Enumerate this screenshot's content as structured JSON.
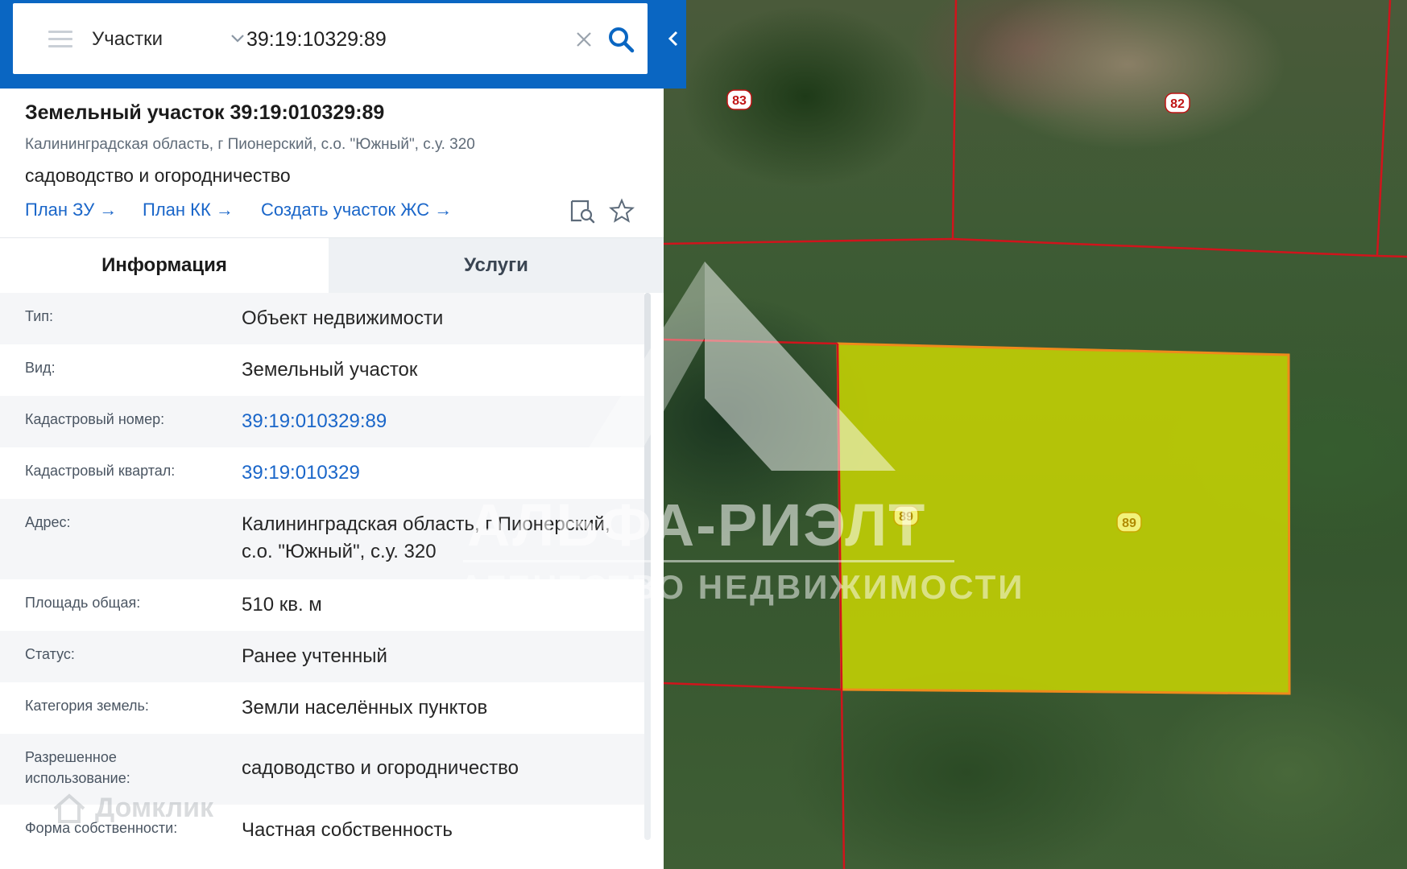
{
  "search": {
    "type_label": "Участки",
    "query": "39:19:10329:89"
  },
  "object": {
    "title": "Земельный участок 39:19:010329:89",
    "address": "Калининградская область, г Пионерский, с.о. \"Южный\", с.у. 320",
    "usage": "садоводство и огородничество",
    "links": [
      "План ЗУ →",
      "План КК →",
      "Создать участок ЖС →"
    ]
  },
  "tabs": [
    {
      "label": "Информация",
      "active": true
    },
    {
      "label": "Услуги",
      "active": false
    }
  ],
  "info_rows": [
    {
      "label": "Тип:",
      "value": "Объект недвижимости",
      "is_link": false
    },
    {
      "label": "Вид:",
      "value": "Земельный участок",
      "is_link": false
    },
    {
      "label": "Кадастровый номер:",
      "value": "39:19:010329:89",
      "is_link": true
    },
    {
      "label": "Кадастровый квартал:",
      "value": "39:19:010329",
      "is_link": true
    },
    {
      "label": "Адрес:",
      "value": "Калининградская область, г Пионерский, с.о. \"Южный\", с.у. 320",
      "is_link": false
    },
    {
      "label": "Площадь общая:",
      "value": "510 кв. м",
      "is_link": false
    },
    {
      "label": "Статус:",
      "value": "Ранее учтенный",
      "is_link": false
    },
    {
      "label": "Категория земель:",
      "value": "Земли населённых пунктов",
      "is_link": false
    },
    {
      "label": "Разрешенное использование:",
      "value": "садоводство и огородничество",
      "is_link": false
    },
    {
      "label": "Форма собственности:",
      "value": "Частная собственность",
      "is_link": false
    }
  ],
  "map": {
    "parcel_labels": [
      "83",
      "82",
      "89",
      "89"
    ],
    "selected_parcel_color": "#d4e000",
    "boundary_color": "#d0141c"
  },
  "watermarks": {
    "brand": "АЛЬФА-РИЭЛТ",
    "tagline": "АГЕНТСТВО НЕДВИЖИМОСТИ",
    "site": "Домклик"
  },
  "colors": {
    "header_blue": "#0a66c2",
    "link_blue": "#1a66c9"
  }
}
